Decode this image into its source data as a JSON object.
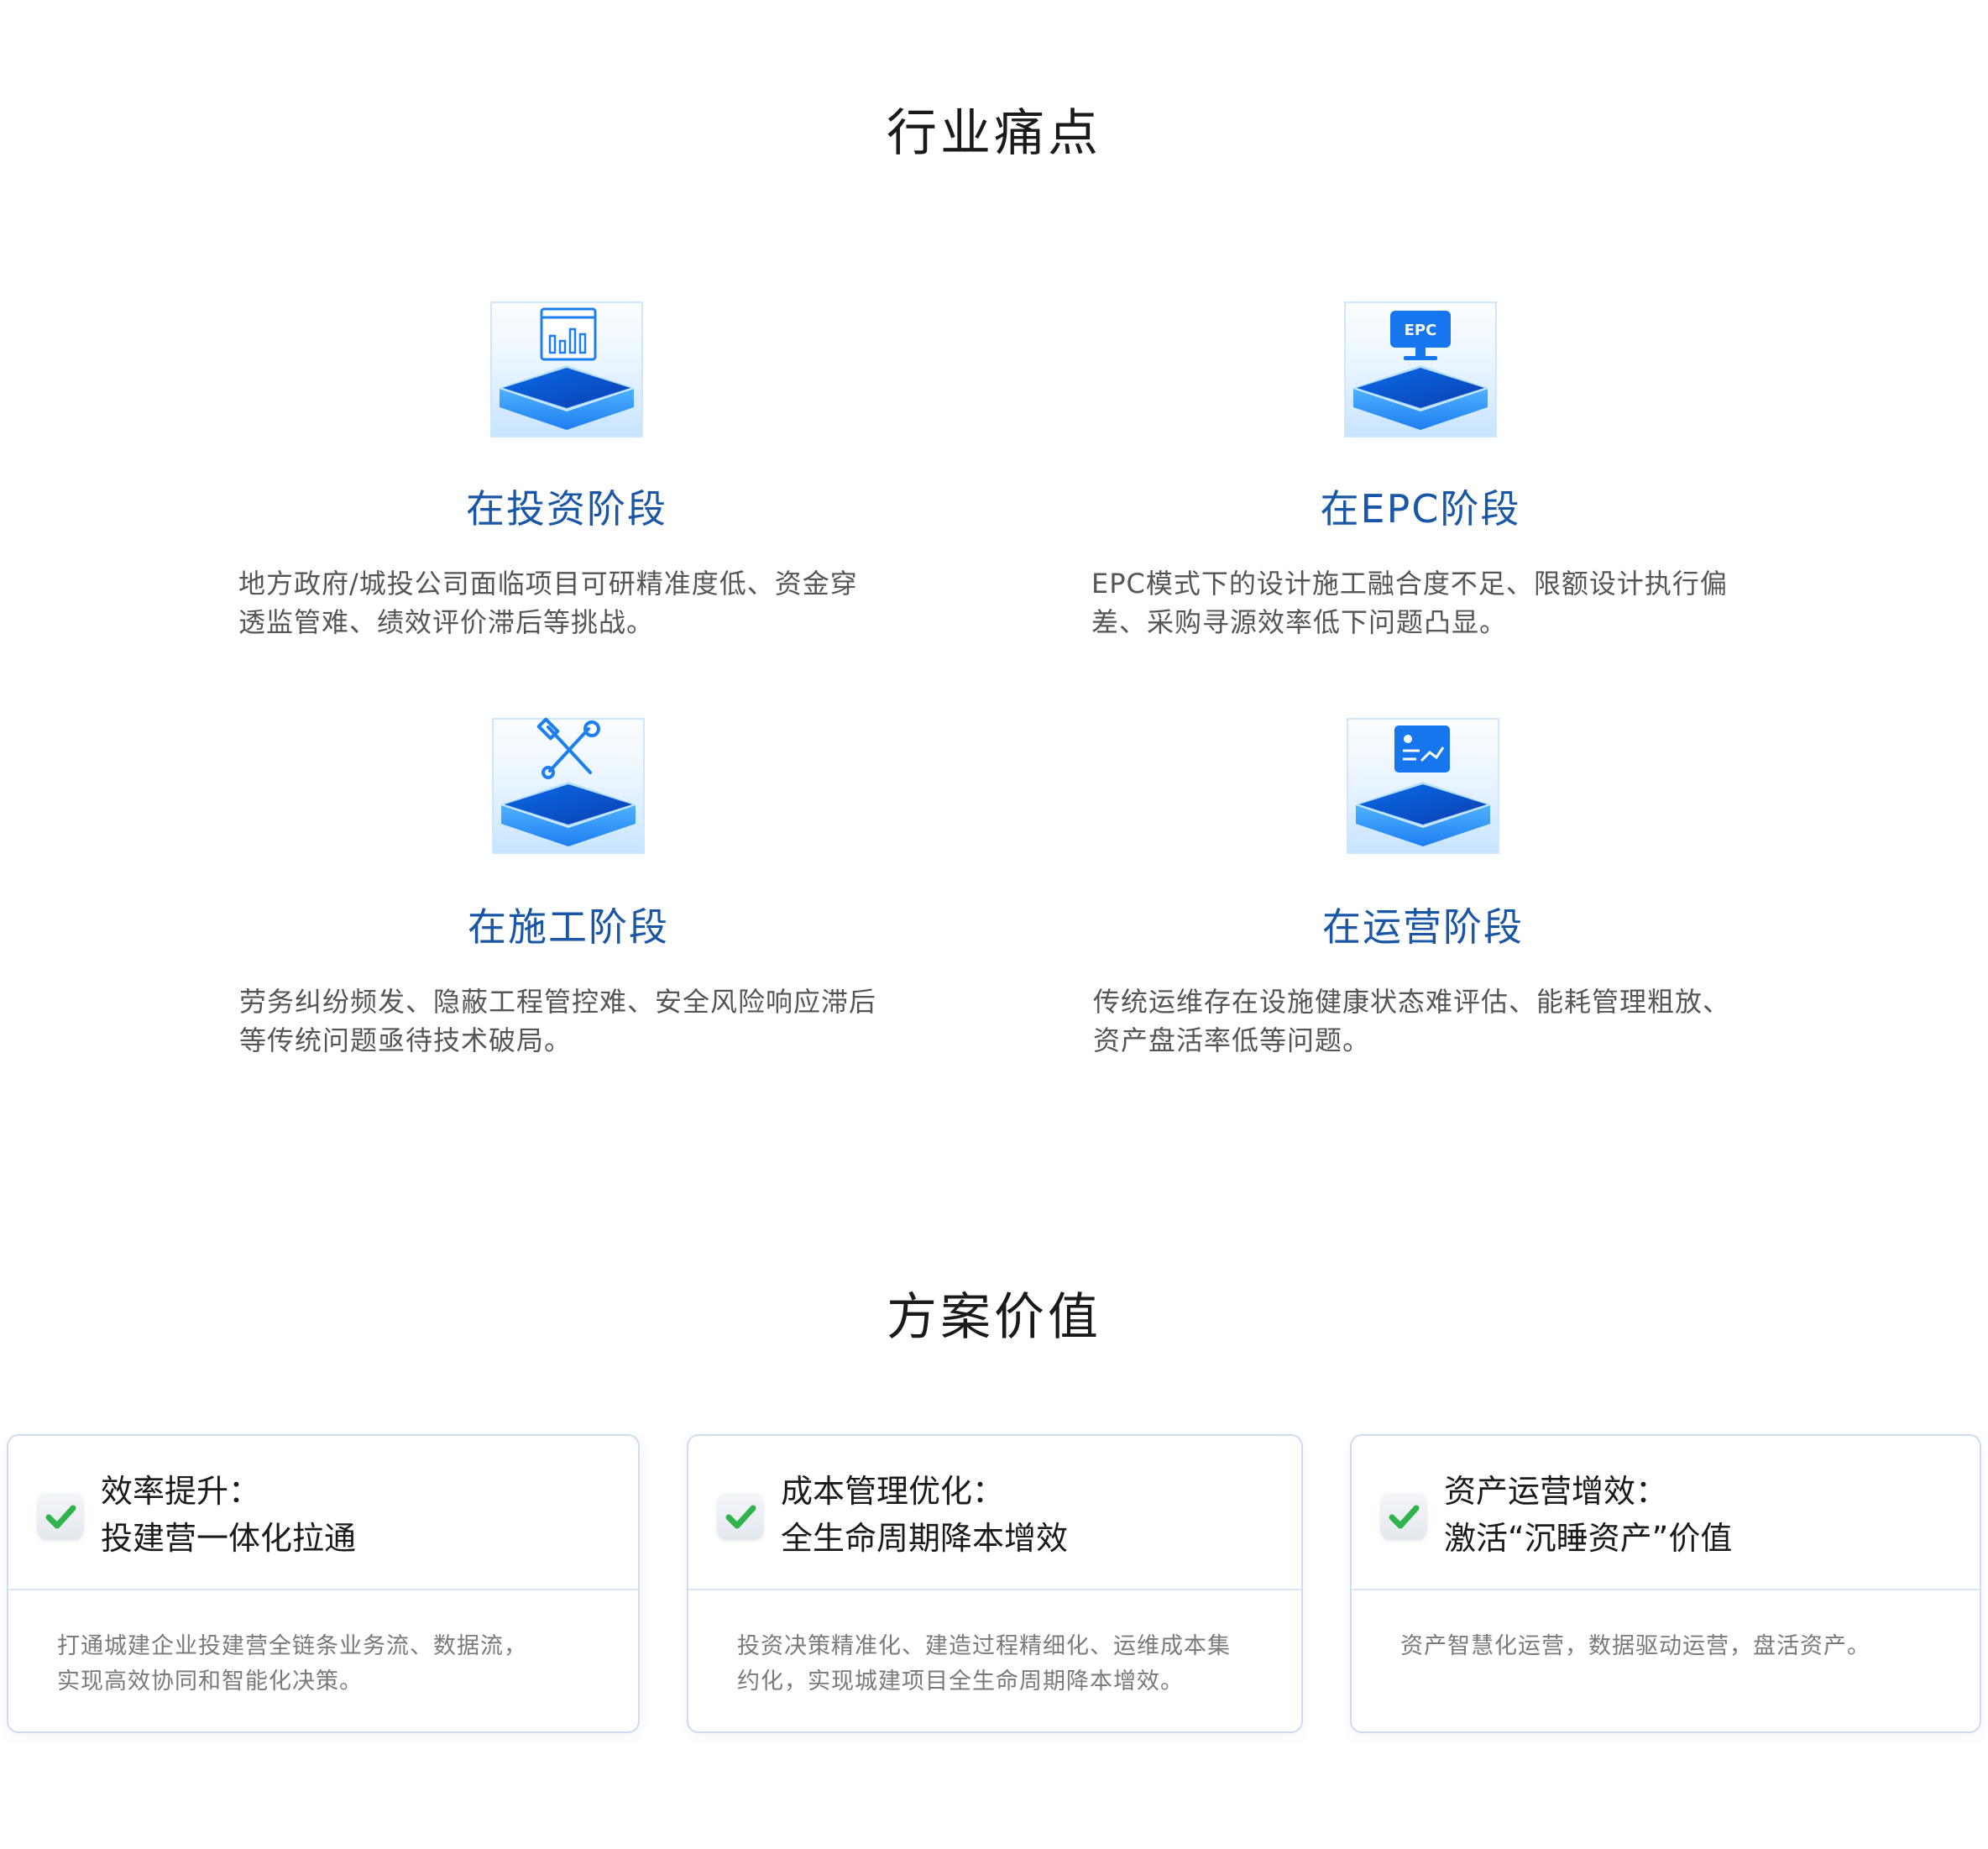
{
  "pain_points": {
    "title": "行业痛点",
    "items": [
      {
        "heading": "在投资阶段",
        "desc_line1": "地方政府/城投公司面临项目可研精准度低、资金穿",
        "desc_line2": "透监管难、绩效评价滞后等挑战。",
        "icon": "bar-chart-window-icon"
      },
      {
        "heading": "在EPC阶段",
        "desc_line1": "EPC模式下的设计施工融合度不足、限额设计执行偏",
        "desc_line2": "差、采购寻源效率低下问题凸显。",
        "icon": "epc-monitor-icon",
        "icon_text": "EPC"
      },
      {
        "heading": "在施工阶段",
        "desc_line1": "劳务纠纷频发、隐蔽工程管控难、安全风险响应滞后",
        "desc_line2": "等传统问题亟待技术破局。",
        "icon": "tools-wrench-hammer-icon"
      },
      {
        "heading": "在运营阶段",
        "desc_line1": "传统运维存在设施健康状态难评估、能耗管理粗放、",
        "desc_line2": "资产盘活率低等问题。",
        "icon": "operations-board-icon"
      }
    ]
  },
  "solution_value": {
    "title": "方案价值",
    "cards": [
      {
        "title_line1": "效率提升：",
        "title_line2": "投建营一体化拉通",
        "desc_line1": "打通城建企业投建营全链条业务流、数据流，",
        "desc_line2": "实现高效协同和智能化决策。"
      },
      {
        "title_line1": "成本管理优化：",
        "title_line2": "全生命周期降本增效",
        "desc_line1": "投资决策精准化、建造过程精细化、运维成本集",
        "desc_line2": "约化，实现城建项目全生命周期降本增效。"
      },
      {
        "title_line1": "资产运营增效：",
        "title_line2": "激活“沉睡资产”价值",
        "desc_line1": "资产智慧化运营，数据驱动运营，盘活资产。",
        "desc_line2": ""
      }
    ]
  },
  "colors": {
    "heading_blue": "#1a56a6",
    "check_green": "#2fb34a",
    "card_border": "#cfdcef"
  }
}
